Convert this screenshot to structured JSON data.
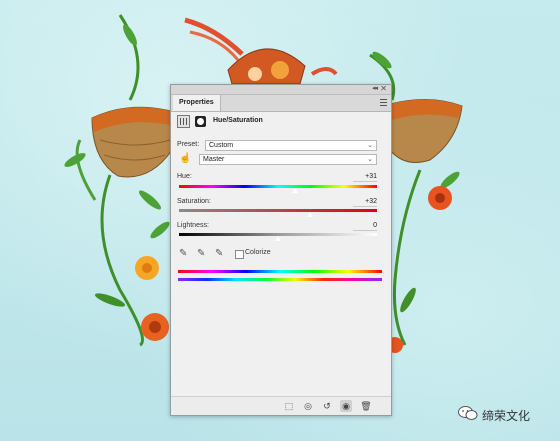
{
  "panel": {
    "tab_label": "Properties",
    "adjustment_title": "Hue/Saturation",
    "preset_label": "Preset:",
    "preset_value": "Custom",
    "channel_value": "Master",
    "hue": {
      "label": "Hue:",
      "value": "+31",
      "level": 0.586
    },
    "saturation": {
      "label": "Saturation:",
      "value": "+32",
      "level": 0.66
    },
    "lightness": {
      "label": "Lightness:",
      "value": "0",
      "level": 0.5
    },
    "colorize_label": "Colorize",
    "colorize_checked": false
  },
  "watermark": {
    "text": "缔荣文化"
  },
  "colors": {
    "background": "#bfe6ea",
    "panel": "#f0f0f0",
    "saturation_track_end": "#e0001a"
  },
  "icons": {
    "collapse": "double-chevron-icon",
    "close": "close-icon",
    "panel_menu": "hamburger-menu-icon",
    "adjustment": "hue-saturation-icon",
    "mask": "layer-mask-icon",
    "targeted_adjust": "hand-icon",
    "eyedropper": "eyedropper-icon",
    "eyedropper_add": "eyedropper-plus-icon",
    "eyedropper_subtract": "eyedropper-minus-icon",
    "clip": "clip-to-layer-icon",
    "view_previous": "view-previous-icon",
    "reset": "reset-icon",
    "visibility": "eye-icon",
    "delete": "trash-icon"
  }
}
